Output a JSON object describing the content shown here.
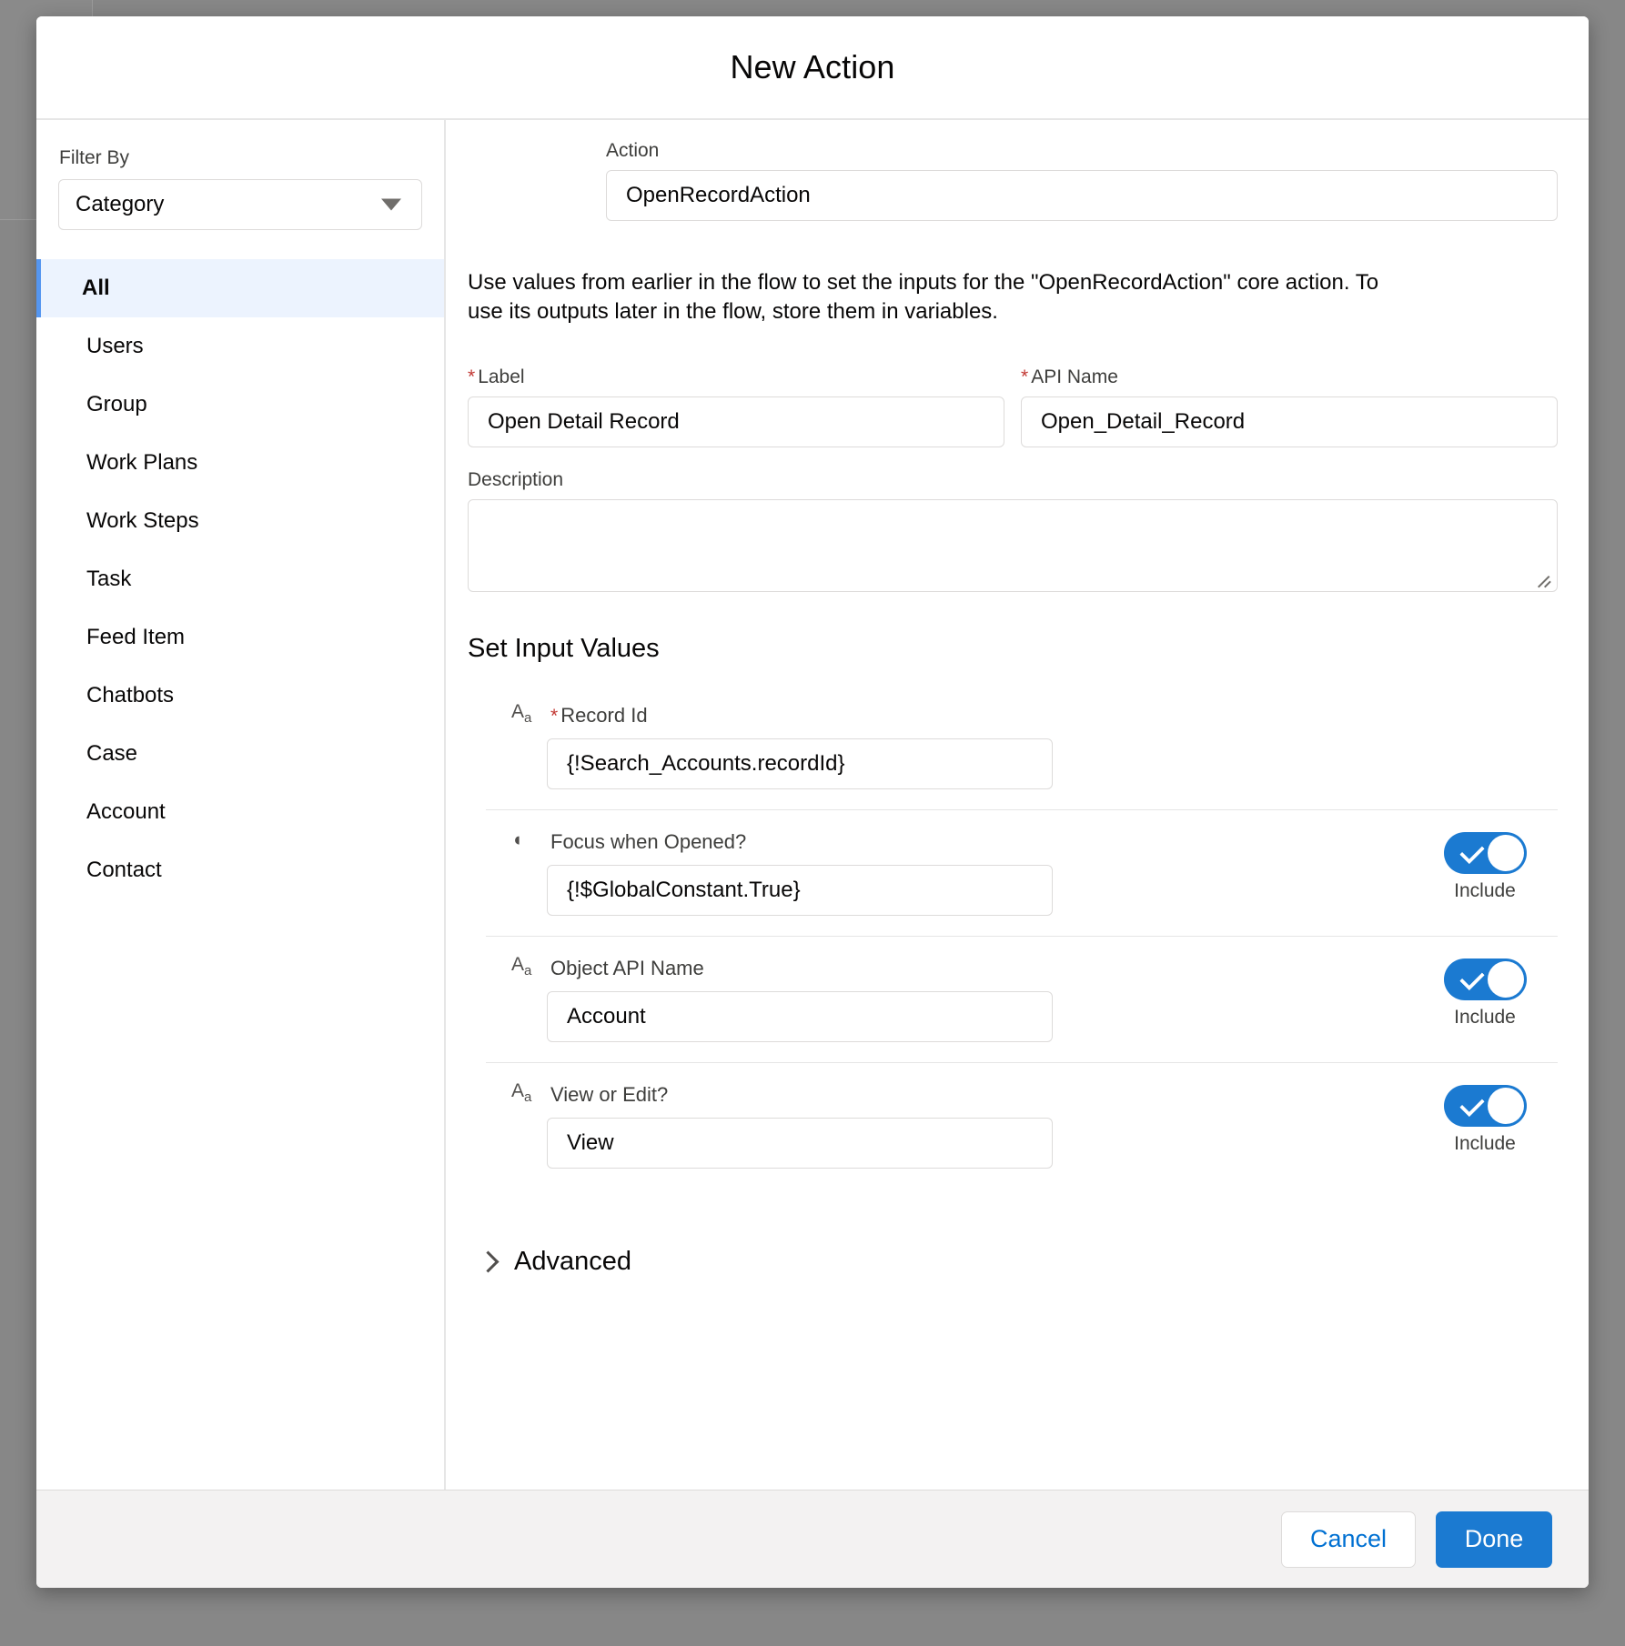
{
  "modal": {
    "title": "New Action"
  },
  "sidebar": {
    "filter_label": "Filter By",
    "filter_value": "Category",
    "caret_icon": "chevron-down-icon",
    "items": [
      {
        "label": "All",
        "selected": true
      },
      {
        "label": "Users",
        "selected": false
      },
      {
        "label": "Group",
        "selected": false
      },
      {
        "label": "Work Plans",
        "selected": false
      },
      {
        "label": "Work Steps",
        "selected": false
      },
      {
        "label": "Task",
        "selected": false
      },
      {
        "label": "Feed Item",
        "selected": false
      },
      {
        "label": "Chatbots",
        "selected": false
      },
      {
        "label": "Case",
        "selected": false
      },
      {
        "label": "Account",
        "selected": false
      },
      {
        "label": "Contact",
        "selected": false
      }
    ]
  },
  "main": {
    "action": {
      "label": "Action",
      "value": "OpenRecordAction"
    },
    "help_text": "Use values from earlier in the flow to set the inputs for the \"OpenRecordAction\" core action. To use its outputs later in the flow, store them in variables.",
    "label_field": {
      "label": "Label",
      "required_marker": "*",
      "value": "Open Detail Record"
    },
    "api_name_field": {
      "label": "API Name",
      "required_marker": "*",
      "value": "Open_Detail_Record"
    },
    "description_field": {
      "label": "Description",
      "value": ""
    },
    "set_input_values": {
      "title": "Set Input Values",
      "rows": [
        {
          "type_icon": "text-type-icon",
          "type_icon_glyph": "A",
          "type_icon_sub": "a",
          "required_marker": "*",
          "required": true,
          "label": "Record Id",
          "value": "{!Search_Accounts.recordId}",
          "has_toggle": false,
          "toggle_caption": "",
          "toggle_on": false
        },
        {
          "type_icon": "boolean-type-icon",
          "type_icon_glyph": "◐",
          "type_icon_sub": "",
          "required_marker": "",
          "required": false,
          "label": "Focus when Opened?",
          "value": "{!$GlobalConstant.True}",
          "has_toggle": true,
          "toggle_caption": "Include",
          "toggle_on": true
        },
        {
          "type_icon": "text-type-icon",
          "type_icon_glyph": "A",
          "type_icon_sub": "a",
          "required_marker": "",
          "required": false,
          "label": "Object API Name",
          "value": "Account",
          "has_toggle": true,
          "toggle_caption": "Include",
          "toggle_on": true
        },
        {
          "type_icon": "text-type-icon",
          "type_icon_glyph": "A",
          "type_icon_sub": "a",
          "required_marker": "",
          "required": false,
          "label": "View or Edit?",
          "value": "View",
          "has_toggle": true,
          "toggle_caption": "Include",
          "toggle_on": true
        }
      ]
    },
    "advanced": {
      "label": "Advanced",
      "chevron_icon": "chevron-right-icon",
      "expanded": false
    }
  },
  "footer": {
    "cancel_label": "Cancel",
    "done_label": "Done"
  },
  "colors": {
    "accent_blue": "#1b7ad1",
    "link_blue": "#0070d2",
    "selected_bg": "#ecf3fe",
    "selected_bar": "#5596f0",
    "required_red": "#c23934",
    "backdrop": "#878787"
  }
}
